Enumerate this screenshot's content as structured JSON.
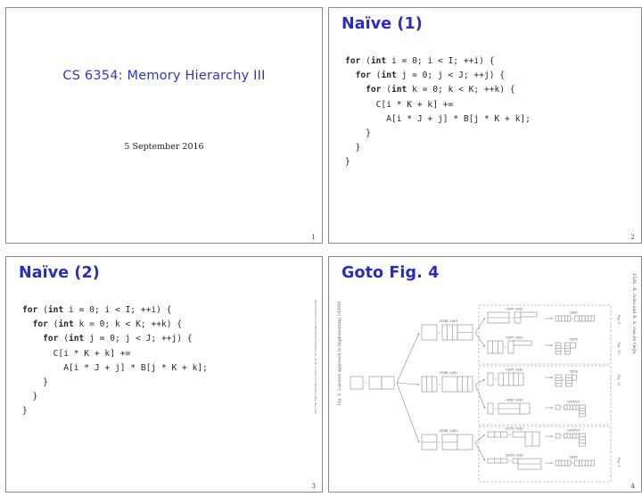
{
  "document": {
    "kind": "lecture-slide-handout",
    "slide_count": 4
  },
  "slides": [
    {
      "id": "slide-1",
      "page_number": "1",
      "title_main": "CS 6354: Memory Hierarchy III",
      "date": "5 September 2016"
    },
    {
      "id": "slide-2",
      "page_number": "2",
      "title": "Naïve (1)",
      "code_lines": [
        "for (int i = 0; i < I; ++i) {",
        "  for (int j = 0; j < J; ++j) {",
        "    for (int k = 0; k < K; ++k) {",
        "      C[i * K + k] +=",
        "        A[i * J + j] * B[j * K + k];",
        "    }",
        "  }",
        "}"
      ],
      "code_keywords": [
        "for",
        "int"
      ]
    },
    {
      "id": "slide-3",
      "page_number": "3",
      "title": "Naïve (2)",
      "code_lines": [
        "for (int i = 0; i < I; ++i) {",
        "  for (int k = 0; k < K; ++k) {",
        "    for (int j = 0; j < J; ++j) {",
        "      C[i * K + k] +=",
        "        A[i * J + j] * B[j * K + k];",
        "    }",
        "  }",
        "}"
      ],
      "code_keywords": [
        "for",
        "int"
      ],
      "side_credit": "ACM Transactions on Mathematical Software, Vol. 34, No. 3, Article 12, Publication date: May 2008."
    },
    {
      "id": "slide-4",
      "page_number": "4",
      "title": "Goto Fig. 4",
      "figure": {
        "caption_left": "Fig. 4.  Layered approach to implementing GEMM",
        "header_right": "1526      ·      K. Goto and R. A. van de Geijn",
        "level1_labels": [
          "GEBB_VAR1",
          "GEBB_VAR2",
          "GEBB_VAR3"
        ],
        "level2_labels": [
          "GEPP_VAR1",
          "GEPP_VAR2",
          "GEBP_VAR1",
          "GEBP_VAR2",
          "GEPM_VAR2",
          "GEPM_VAR1"
        ],
        "level3_labels": [
          "GEBP",
          "GEPB",
          "GEPB",
          "GEPDOT",
          "GEPDOT",
          "GEBP"
        ],
        "fig_refs": [
          "Fig. 8",
          "Fig. 10",
          "Fig. 11",
          "Fig. 9"
        ]
      }
    }
  ]
}
